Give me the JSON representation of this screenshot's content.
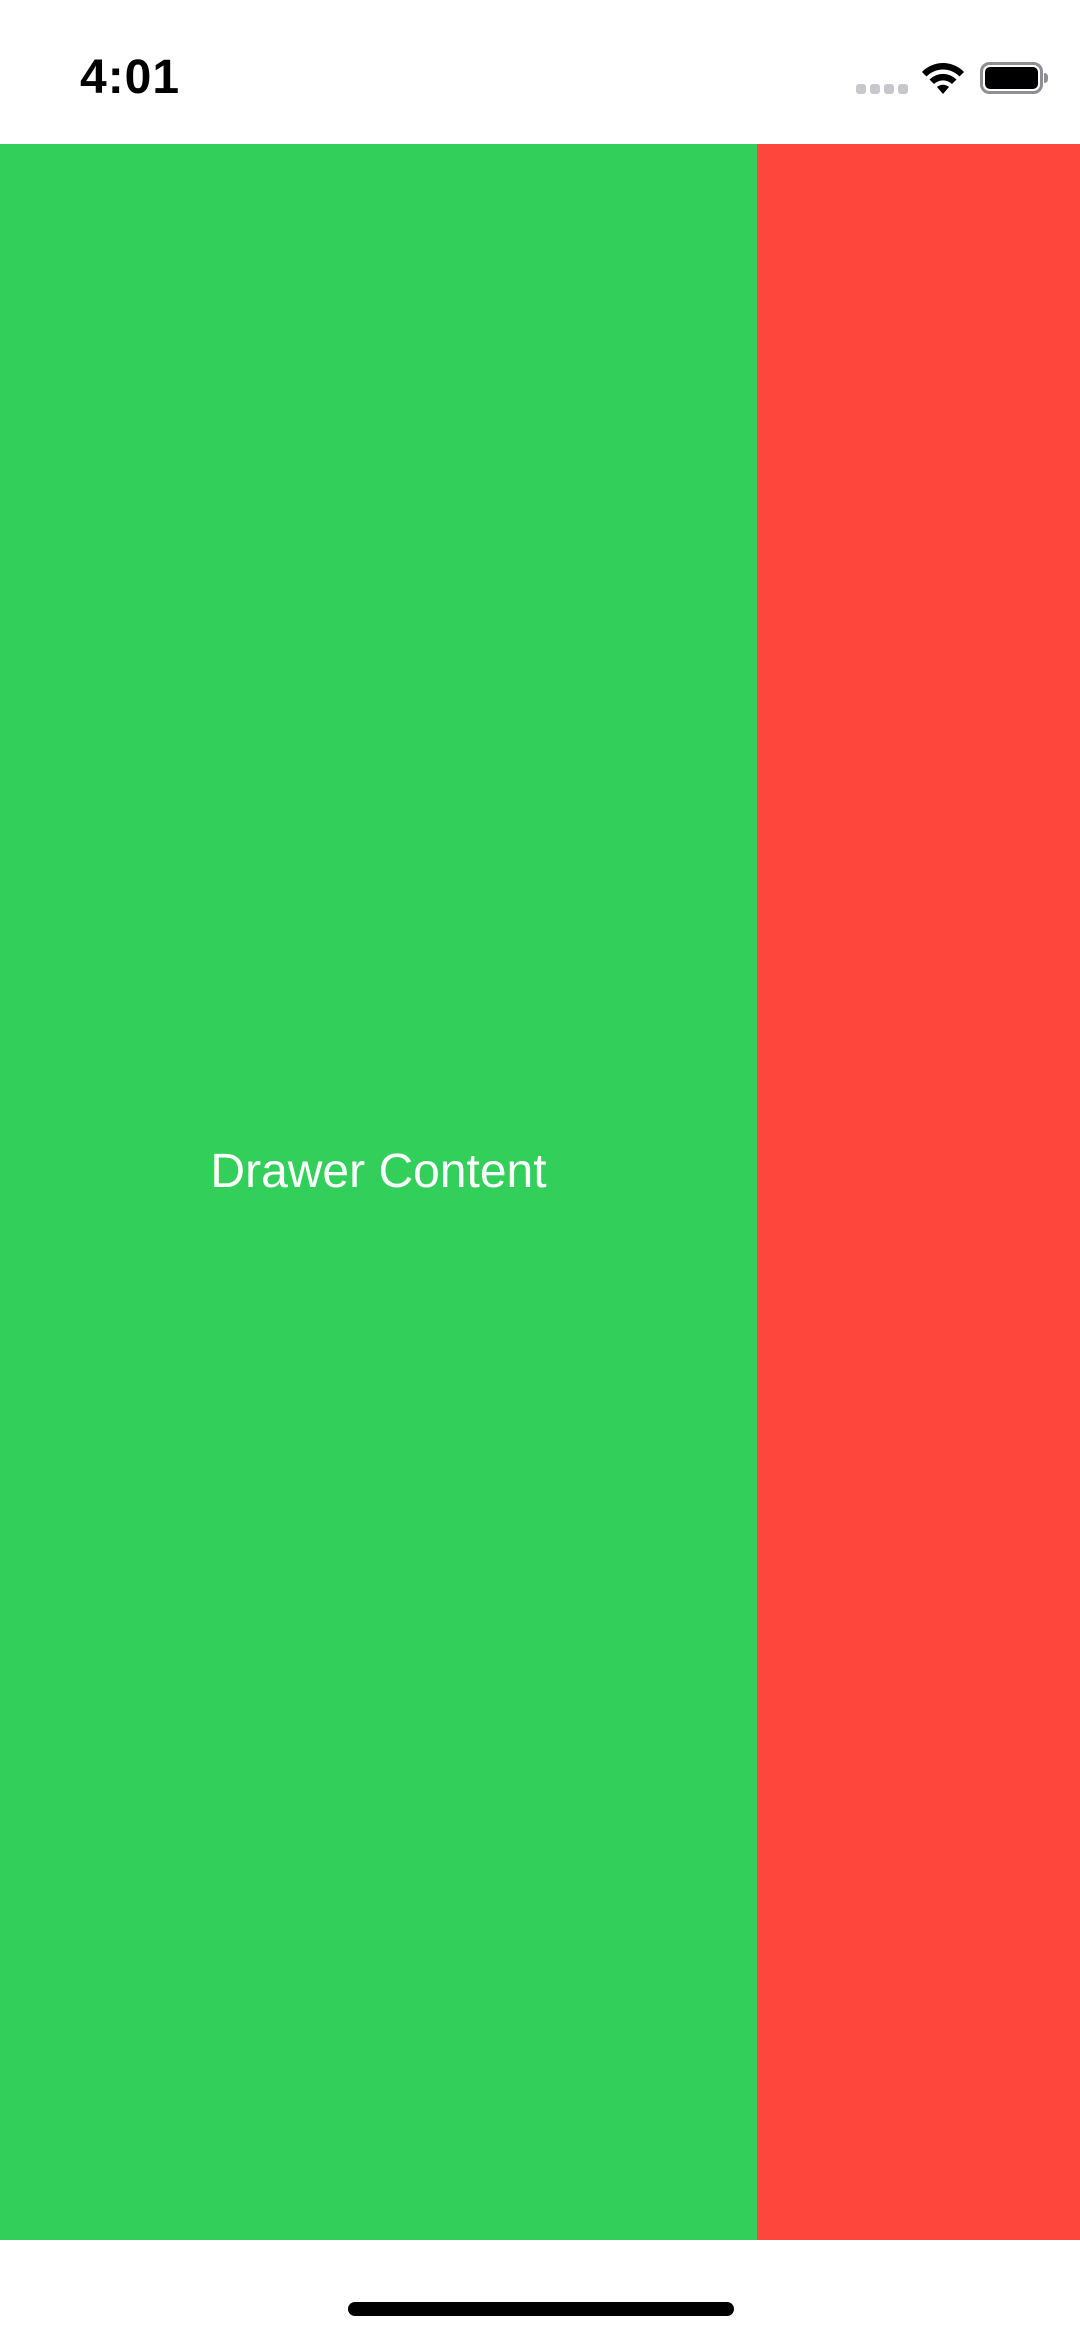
{
  "status_bar": {
    "time": "4:01",
    "wifi_icon": "wifi-icon",
    "battery_icon": "battery-icon",
    "signal_icon": "cellular-signal-icon"
  },
  "drawer": {
    "label": "Drawer Content",
    "color": "#32d05a"
  },
  "main_view": {
    "color": "#fe463c"
  },
  "home_indicator": {
    "icon": "home-indicator"
  }
}
